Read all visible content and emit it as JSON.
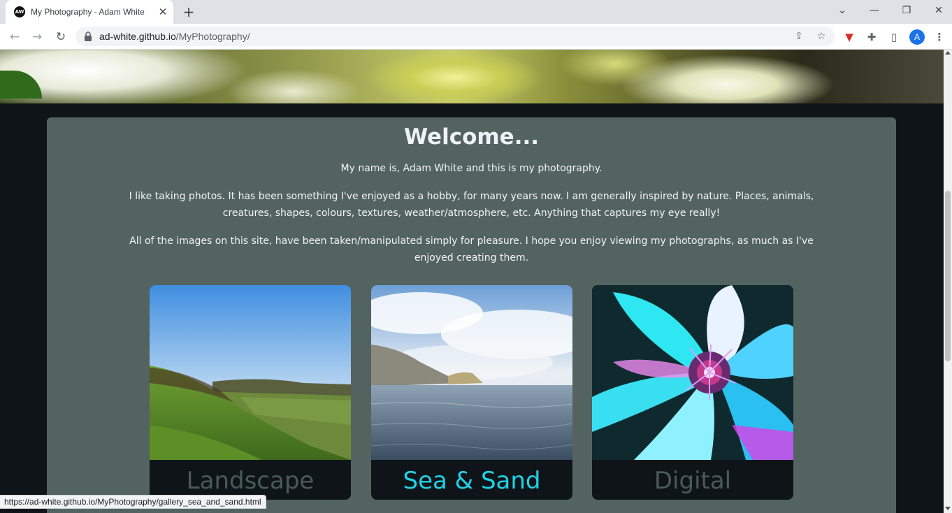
{
  "browser": {
    "tab_title": "My Photography - Adam White",
    "tab_favicon_text": "AW",
    "url_host": "ad-white.github.io",
    "url_path": "/MyPhotography/",
    "profile_initial": "A",
    "status_url": "https://ad-white.github.io/MyPhotography/gallery_sea_and_sand.html"
  },
  "page": {
    "welcome_title": "Welcome...",
    "intro_1": "My name is, Adam White and this is my photography.",
    "intro_2": "I like taking photos. It has been something I've enjoyed as a hobby, for many years now. I am generally inspired by nature. Places, animals, creatures, shapes, colours, textures, weather/atmosphere, etc. Anything that captures my eye really!",
    "intro_3": "All of the images on this site, have been taken/manipulated simply for pleasure. I hope you enjoy viewing my photographs, as much as I've enjoyed creating them."
  },
  "galleries": [
    {
      "label": "Landscape",
      "label_color": "#4a5a58",
      "hovered": false
    },
    {
      "label": "Sea & Sand",
      "label_color": "#1fd3e6",
      "hovered": true
    },
    {
      "label": "Digital",
      "label_color": "#4a5a58",
      "hovered": false
    }
  ],
  "colors": {
    "page_bg": "#0f1419",
    "panel_bg": "#536360",
    "text": "#f3f4f8",
    "accent": "#1fd3e6"
  }
}
